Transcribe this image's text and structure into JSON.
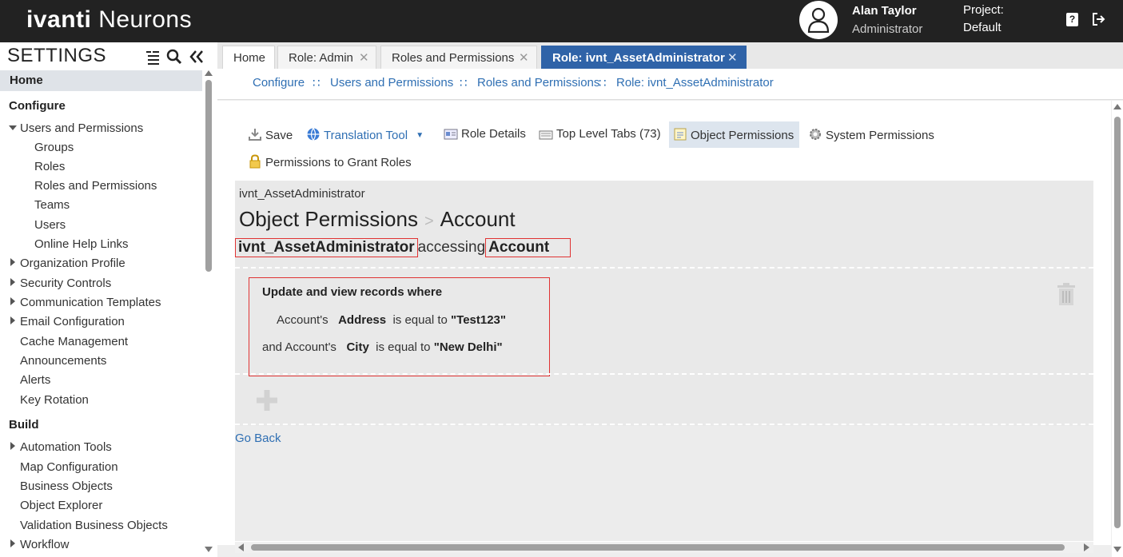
{
  "header": {
    "logo_bold": "ivanti",
    "logo_light": "Neurons",
    "user_name": "Alan Taylor",
    "user_role": "Administrator",
    "project_label": "Project:",
    "project_value": "Default",
    "help_glyph": "?",
    "icons": [
      "user-avatar-icon",
      "help-icon",
      "logout-icon"
    ]
  },
  "sidebar": {
    "title": "SETTINGS",
    "home": "Home",
    "sections": {
      "configure": {
        "label": "Configure",
        "items": [
          {
            "label": "Users and Permissions",
            "expanded": true
          },
          {
            "label": "Groups"
          },
          {
            "label": "Roles"
          },
          {
            "label": "Roles and Permissions"
          },
          {
            "label": "Teams"
          },
          {
            "label": "Users"
          },
          {
            "label": "Online Help Links"
          },
          {
            "label": "Organization Profile",
            "collapsed": true
          },
          {
            "label": "Security Controls",
            "collapsed": true
          },
          {
            "label": "Communication Templates",
            "collapsed": true
          },
          {
            "label": "Email Configuration",
            "collapsed": true
          },
          {
            "label": "Cache Management"
          },
          {
            "label": "Announcements"
          },
          {
            "label": "Alerts"
          },
          {
            "label": "Key Rotation"
          }
        ]
      },
      "build": {
        "label": "Build",
        "items": [
          {
            "label": "Automation Tools",
            "collapsed": true
          },
          {
            "label": "Map Configuration"
          },
          {
            "label": "Business Objects"
          },
          {
            "label": "Object Explorer"
          },
          {
            "label": "Validation Business Objects"
          },
          {
            "label": "Workflow",
            "collapsed": true
          }
        ]
      }
    }
  },
  "tabs": [
    {
      "label": "Home"
    },
    {
      "label": "Role: Admin",
      "close": "✕"
    },
    {
      "label": "Roles and Permissions",
      "close": "✕"
    },
    {
      "label": "Role: ivnt_AssetAdministrator",
      "close": "✕",
      "active": true
    }
  ],
  "breadcrumb": {
    "items": [
      "Configure",
      "Users and Permissions",
      "Roles and Permissions",
      "Role: ivnt_AssetAdministrator"
    ],
    "separator": "∷"
  },
  "toolbar": {
    "save": "Save",
    "translation_tool": "Translation Tool",
    "role_details": "Role Details",
    "top_level_tabs": "Top Level Tabs (73)",
    "object_permissions": "Object Permissions",
    "system_permissions": "System Permissions",
    "permissions_to_grant_roles": "Permissions to Grant Roles"
  },
  "panel": {
    "role_name_small": "ivnt_AssetAdministrator",
    "title": "Object Permissions",
    "title_separator": ">",
    "title_object": "Account",
    "role_name": "ivnt_AssetAdministrator",
    "accessing": "accessing",
    "object_name": "Account",
    "rule": {
      "heading": "Update and view records where",
      "line1": {
        "prefix": "Account's",
        "field": "Address",
        "op": "is equal to",
        "value": "\"Test123\""
      },
      "line2": {
        "prefix": "and Account's",
        "field": "City",
        "op": "is equal to",
        "value": "\"New Delhi\""
      }
    },
    "go_back": "Go Back"
  },
  "colors": {
    "topbar": "#222222",
    "active_tab": "#2f63a8",
    "link": "#2f6fb3",
    "highlight_box": "#e03333"
  }
}
